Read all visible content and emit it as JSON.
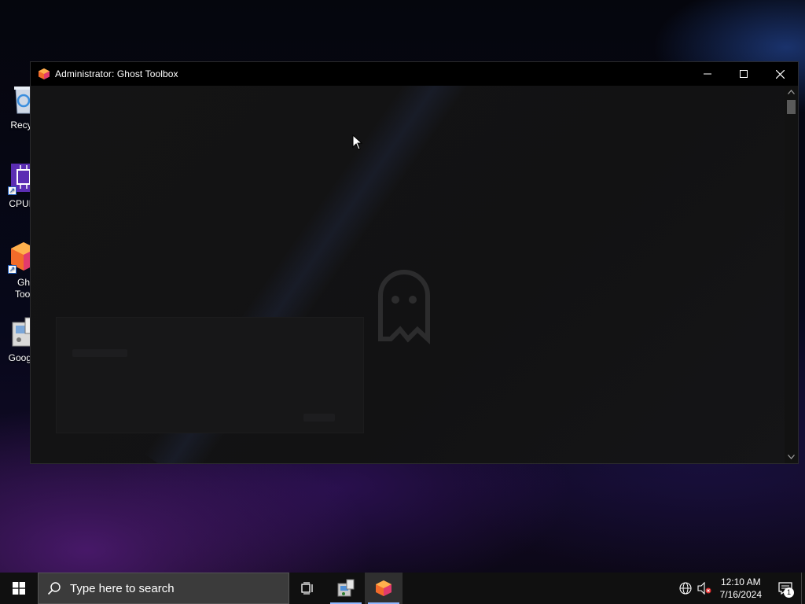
{
  "desktop": {
    "icons": [
      {
        "label": "Recyc",
        "icon": "recycle-bin-icon"
      },
      {
        "label": "CPUID",
        "icon": "cpuid-icon"
      },
      {
        "label": "Gh",
        "label2": "Tool",
        "icon": "ghost-toolbox-icon"
      },
      {
        "label": "Google",
        "icon": "google-installer-icon"
      }
    ]
  },
  "window": {
    "title": "Administrator:  Ghost Toolbox",
    "controls": [
      "minimize-icon",
      "maximize-icon",
      "close-icon"
    ]
  },
  "taskbar": {
    "search_placeholder": "Type here to search",
    "apps": [
      "task-view-icon",
      "control-panel-icon",
      "ghost-toolbox-icon"
    ],
    "clock_time": "12:10 AM",
    "clock_date": "7/16/2024",
    "notification_count": "1"
  },
  "colors": {
    "accent": "#8fb8ff",
    "ghost_orange": "#f26b2a",
    "ghost_pink": "#e23a6e"
  }
}
